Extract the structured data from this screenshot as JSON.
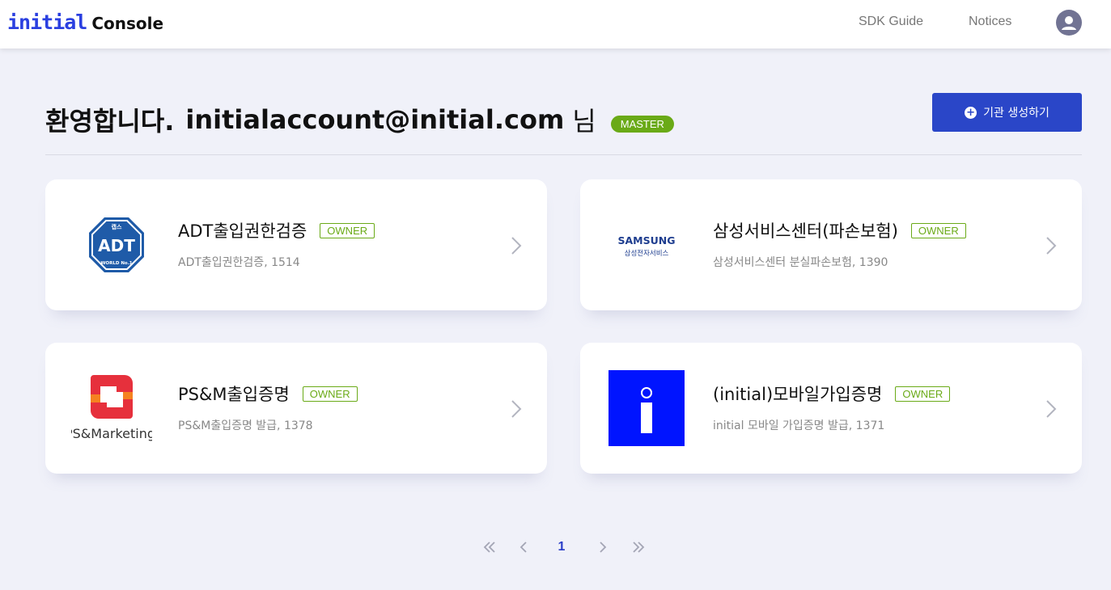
{
  "header": {
    "logo_brand": "initial",
    "logo_product": "Console",
    "nav": [
      "SDK Guide",
      "Notices"
    ],
    "avatar_icon": "user-icon"
  },
  "welcome": {
    "prefix": "환영합니다.",
    "email": "initialaccount@initial.com",
    "suffix": "님",
    "role_badge": "MASTER"
  },
  "create_button": {
    "label": "기관 생성하기",
    "icon": "plus-circle-icon"
  },
  "colors": {
    "accent": "#2a46c8",
    "badge_green": "#6aaa17",
    "background": "#f0f1f9"
  },
  "cards": [
    {
      "title": "ADT출입권한검증",
      "badge": "OWNER",
      "desc": "ADT출입권한검증, 1514",
      "logo": {
        "top": "캡스",
        "main": "ADT",
        "bottom": "WORLD No.1"
      }
    },
    {
      "title": "삼성서비스센터(파손보험)",
      "badge": "OWNER",
      "desc": "삼성서비스센터 분실파손보험, 1390",
      "logo": {
        "main": "SAMSUNG",
        "sub": "삼성전자서비스"
      }
    },
    {
      "title": "PS&M출입증명",
      "badge": "OWNER",
      "desc": "PS&M출입증명 발급, 1378",
      "logo": {
        "main": "PS&Marketing"
      }
    },
    {
      "title": "(initial)모바일가입증명",
      "badge": "OWNER",
      "desc": "initial 모바일 가입증명 발급, 1371",
      "logo": {
        "main": "initial-i-logo"
      }
    }
  ],
  "pagination": {
    "current_page": "1",
    "icons": [
      "double-chevron-left-icon",
      "chevron-left-icon",
      "chevron-right-icon",
      "double-chevron-right-icon"
    ]
  }
}
